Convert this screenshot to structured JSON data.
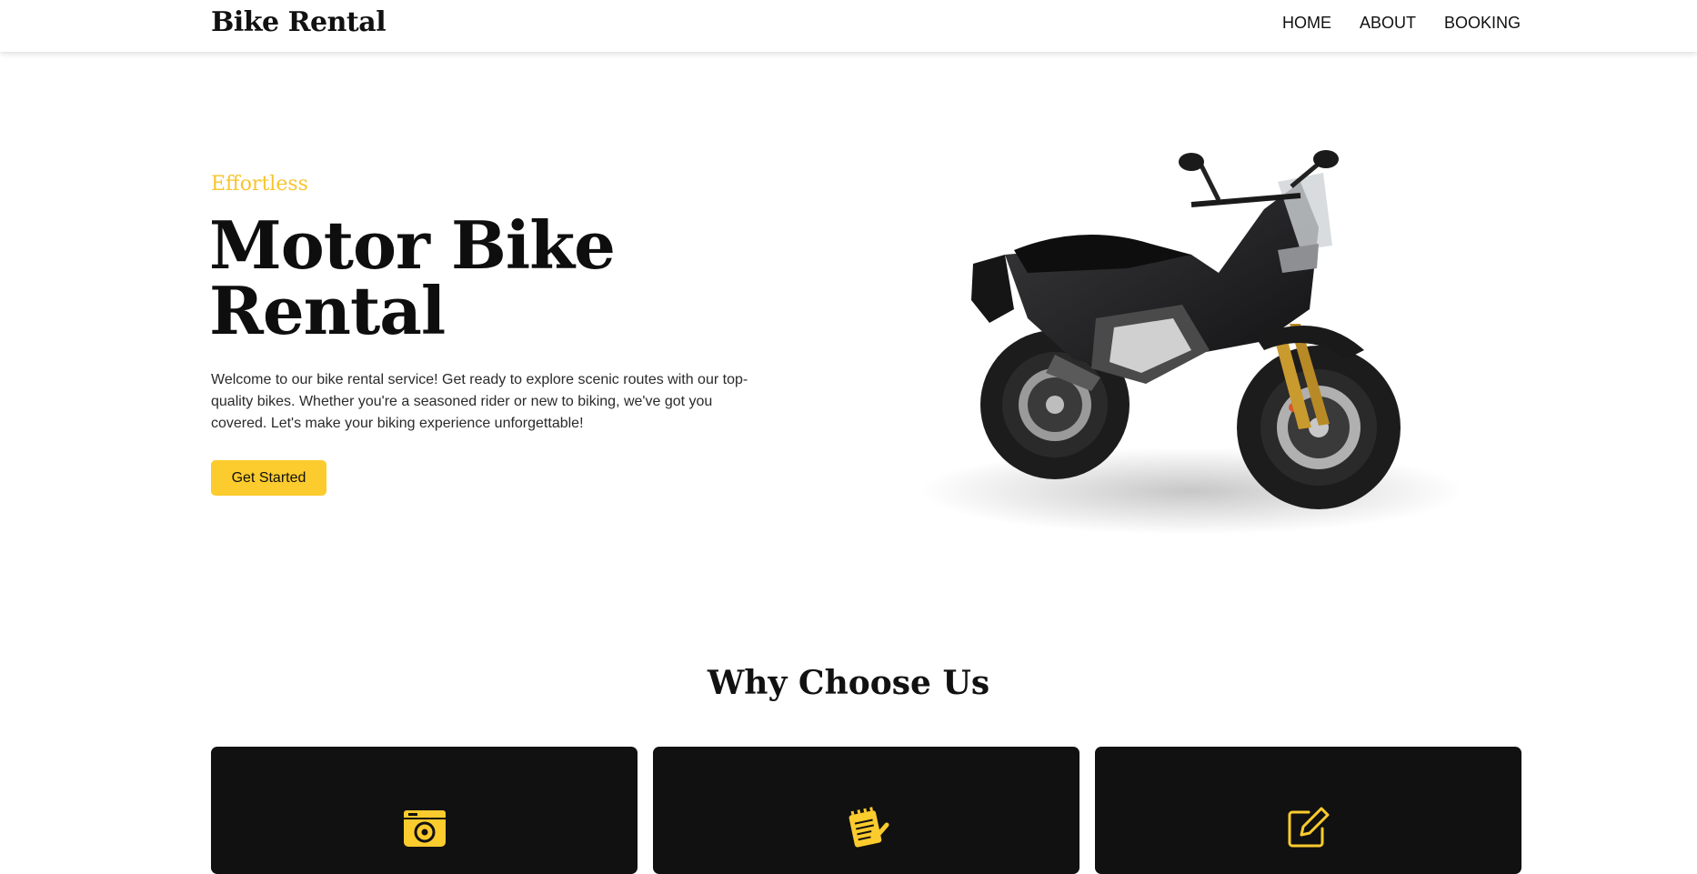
{
  "header": {
    "brand": "Bike Rental",
    "nav": [
      {
        "label": "HOME"
      },
      {
        "label": "ABOUT"
      },
      {
        "label": "BOOKING"
      }
    ]
  },
  "hero": {
    "eyebrow": "Effortless",
    "title": "Motor Bike Rental",
    "description": "Welcome to our bike rental service! Get ready to explore scenic routes with our top-quality bikes. Whether you're a seasoned rider or new to biking, we've got you covered. Let's make your biking experience unforgettable!",
    "cta_label": "Get Started",
    "image": "motorbike-photo"
  },
  "why_choose_us": {
    "title": "Why Choose Us",
    "cards": [
      {
        "icon": "wallet-icon"
      },
      {
        "icon": "notepad-icon"
      },
      {
        "icon": "edit-icon"
      }
    ]
  },
  "colors": {
    "accent": "#fccb2d",
    "card_background": "#111111",
    "text": "#111111"
  }
}
